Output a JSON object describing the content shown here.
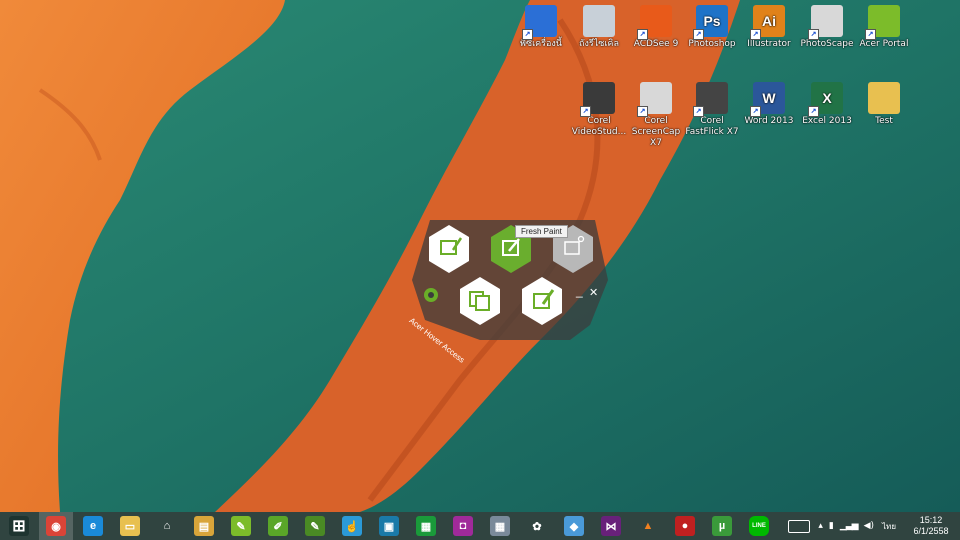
{
  "desktop_icons": [
    {
      "name": "this-pc",
      "label": "พีซีเครื่องนี้",
      "icon": "computer-icon",
      "color": "#2b6fd6"
    },
    {
      "name": "recycle-bin",
      "label": "ถังรีไซเคิล",
      "icon": "trash-icon",
      "color": "#c8d0d8"
    },
    {
      "name": "acdsee",
      "label": "ACDSee 9",
      "icon": "camera-icon",
      "color": "#e85a1a"
    },
    {
      "name": "photoshop",
      "label": "Photoshop",
      "icon": "photoshop-icon",
      "color": "#1e73c8",
      "glyph": "Ps"
    },
    {
      "name": "illustrator",
      "label": "Illustrator",
      "icon": "illustrator-icon",
      "color": "#e0821a",
      "glyph": "Ai"
    },
    {
      "name": "photoscape",
      "label": "PhotoScape",
      "icon": "photoscape-icon",
      "color": "#d8d8d8"
    },
    {
      "name": "acer-portal",
      "label": "Acer Portal",
      "icon": "cloud-icon",
      "color": "#7cbc2a"
    },
    {
      "name": "corel-videostudio",
      "label": "Corel VideoStud...",
      "icon": "film-icon",
      "color": "#3a3a3a"
    },
    {
      "name": "corel-screencap",
      "label": "Corel ScreenCap X7",
      "icon": "record-icon",
      "color": "#d8d8d8"
    },
    {
      "name": "corel-fastflick",
      "label": "Corel FastFlick X7",
      "icon": "magic-wand-icon",
      "color": "#444"
    },
    {
      "name": "word-2013",
      "label": "Word 2013",
      "icon": "word-icon",
      "color": "#2b579a",
      "glyph": "W"
    },
    {
      "name": "excel-2013",
      "label": "Excel 2013",
      "icon": "excel-icon",
      "color": "#217346",
      "glyph": "X"
    },
    {
      "name": "test-folder",
      "label": "Test",
      "icon": "folder-icon",
      "color": "#e8c050"
    }
  ],
  "hover_access": {
    "title": "Acer Hover Access",
    "tooltip": "Fresh Paint",
    "minimize": "_",
    "close": "✕"
  },
  "taskbar": {
    "apps": [
      {
        "name": "start",
        "icon": "windows-logo-icon",
        "color": "#1e3430",
        "glyph": "⊞"
      },
      {
        "name": "chrome",
        "icon": "chrome-icon",
        "color": "#db4437",
        "glyph": "◉",
        "active": true
      },
      {
        "name": "ie",
        "icon": "internet-explorer-icon",
        "color": "#1a8ad8",
        "glyph": "e"
      },
      {
        "name": "file-explorer",
        "icon": "folder-icon",
        "color": "#e8c050",
        "glyph": "▭"
      },
      {
        "name": "home",
        "icon": "home-icon",
        "color": "transparent",
        "glyph": "⌂"
      },
      {
        "name": "app-notes",
        "icon": "notebook-icon",
        "color": "#d9a53a",
        "glyph": "▤"
      },
      {
        "name": "app-green1",
        "icon": "pen-icon",
        "color": "#7cbc2a",
        "glyph": "✎"
      },
      {
        "name": "app-green2",
        "icon": "paint-icon",
        "color": "#5aa628",
        "glyph": "✐"
      },
      {
        "name": "app-green3",
        "icon": "edit-icon",
        "color": "#4a8a24",
        "glyph": "✎"
      },
      {
        "name": "app-touch",
        "icon": "touch-icon",
        "color": "#2b9ad8",
        "glyph": "☝"
      },
      {
        "name": "app-media",
        "icon": "media-icon",
        "color": "#1a7aa8",
        "glyph": "▣"
      },
      {
        "name": "app-store",
        "icon": "store-icon",
        "color": "#1a9a3a",
        "glyph": "▦"
      },
      {
        "name": "app-camera",
        "icon": "camera-icon",
        "color": "#a02a9a",
        "glyph": "◘"
      },
      {
        "name": "calculator",
        "icon": "calculator-icon",
        "color": "#7a8a9a",
        "glyph": "▦"
      },
      {
        "name": "paint",
        "icon": "palette-icon",
        "color": "transparent",
        "glyph": "✿"
      },
      {
        "name": "app-cube",
        "icon": "cube-icon",
        "color": "#4a9ad8",
        "glyph": "◆"
      },
      {
        "name": "visual-studio",
        "icon": "visual-studio-icon",
        "color": "#68217a",
        "glyph": "⋈"
      },
      {
        "name": "vlc",
        "icon": "vlc-cone-icon",
        "color": "transparent",
        "glyph": "▲"
      },
      {
        "name": "app-red",
        "icon": "record-icon",
        "color": "#c02020",
        "glyph": "●"
      },
      {
        "name": "utorrent",
        "icon": "utorrent-icon",
        "color": "#3a9a3a",
        "glyph": "µ"
      },
      {
        "name": "line",
        "icon": "line-chat-icon",
        "color": "#00b900",
        "glyph": "LINE"
      }
    ],
    "tray": {
      "language": "ไทย",
      "time": "15:12",
      "date": "6/1/2558"
    }
  },
  "colors": {
    "sand": "#e8742a",
    "sea": "#1f7a6a",
    "accent": "#78b82a"
  }
}
